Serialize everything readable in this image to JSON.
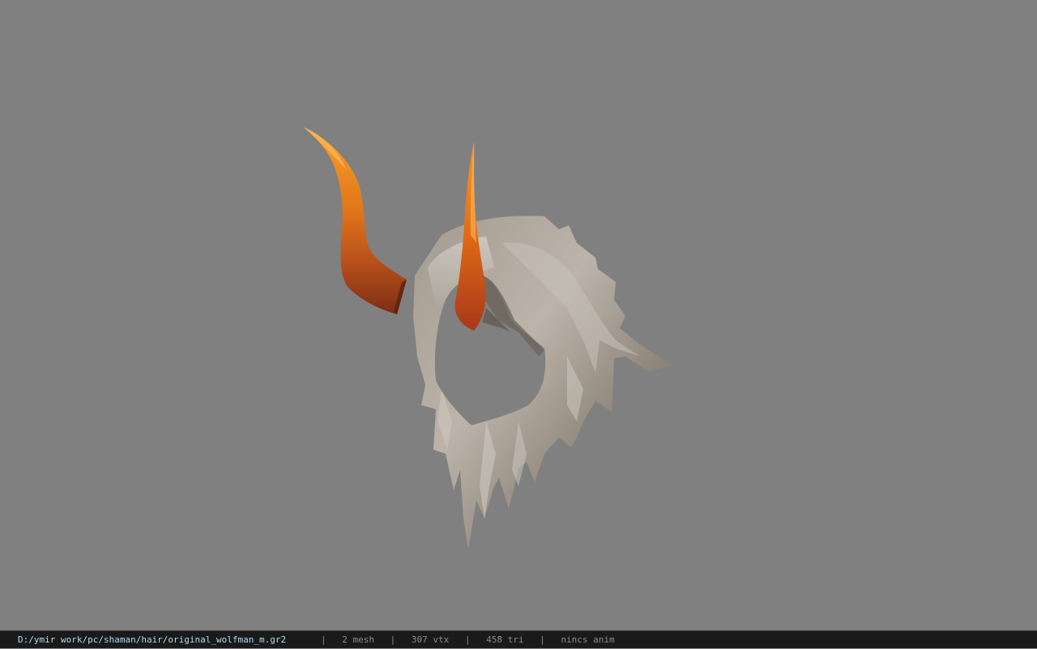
{
  "viewport": {
    "background_color": "#808080",
    "model": {
      "name": "wolfman hair with horns",
      "horn_colors": [
        "#f28a1e",
        "#c25a1c",
        "#7a2a10"
      ],
      "hair_colors": [
        "#d8d3cc",
        "#a39a8f",
        "#6f655a"
      ]
    }
  },
  "status_bar": {
    "file_path": "D:/ymir work/pc/shaman/hair/original_wolfman_m.gr2",
    "separator": "|",
    "mesh_count": "2 mesh",
    "vertex_count": "307 vtx",
    "triangle_count": "458 tri",
    "anim_info": "nincs anim",
    "path_color": "#a9dcef",
    "text_color": "#8a8a8a"
  }
}
